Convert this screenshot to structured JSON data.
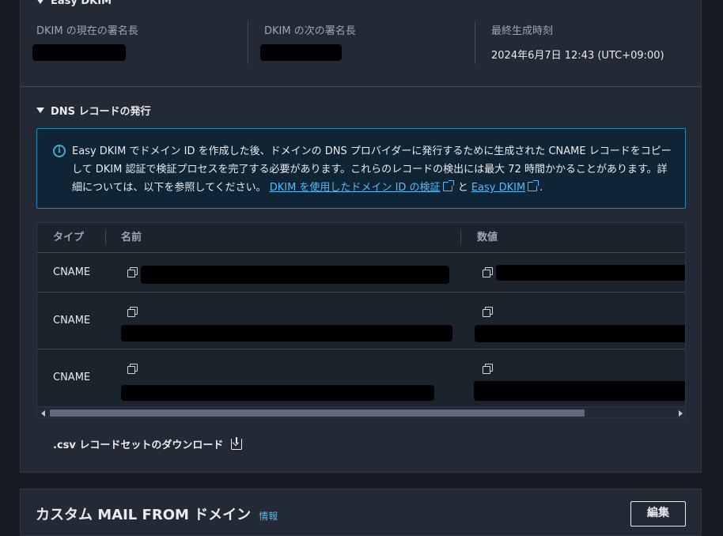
{
  "easy_dkim": {
    "title": "Easy DKIM",
    "current_key_label": "DKIM の現在の署名長",
    "next_key_label": "DKIM の次の署名長",
    "last_generated_label": "最終生成時刻",
    "last_generated_value": "2024年6月7日 12:43 (UTC+09:00)"
  },
  "dns_records": {
    "title": "DNS レコードの発行",
    "info_text": "Easy DKIM でドメイン ID を作成した後、ドメインの DNS プロバイダーに発行するために生成された CNAME レコードをコピーして DKIM 認証で検証プロセスを完了する必要があります。これらのレコードの検出には最大 72 時間かかることがあります。詳細については、以下を参照してください。",
    "link1": "DKIM を使用したドメイン ID の検証",
    "between": "と",
    "link2": "Easy DKIM",
    "end": ".",
    "columns": [
      "タイプ",
      "名前",
      "数値"
    ],
    "rows": [
      {
        "type": "CNAME"
      },
      {
        "type": "CNAME"
      },
      {
        "type": "CNAME"
      }
    ],
    "download_label": ".csv レコードセットのダウンロード"
  },
  "custom_mail_from": {
    "title": "カスタム MAIL FROM ドメイン",
    "info_link": "情報",
    "edit_label": "編集"
  },
  "icons": [
    "caret-down-icon",
    "info-icon",
    "external-link-icon",
    "copy-icon",
    "download-icon"
  ]
}
